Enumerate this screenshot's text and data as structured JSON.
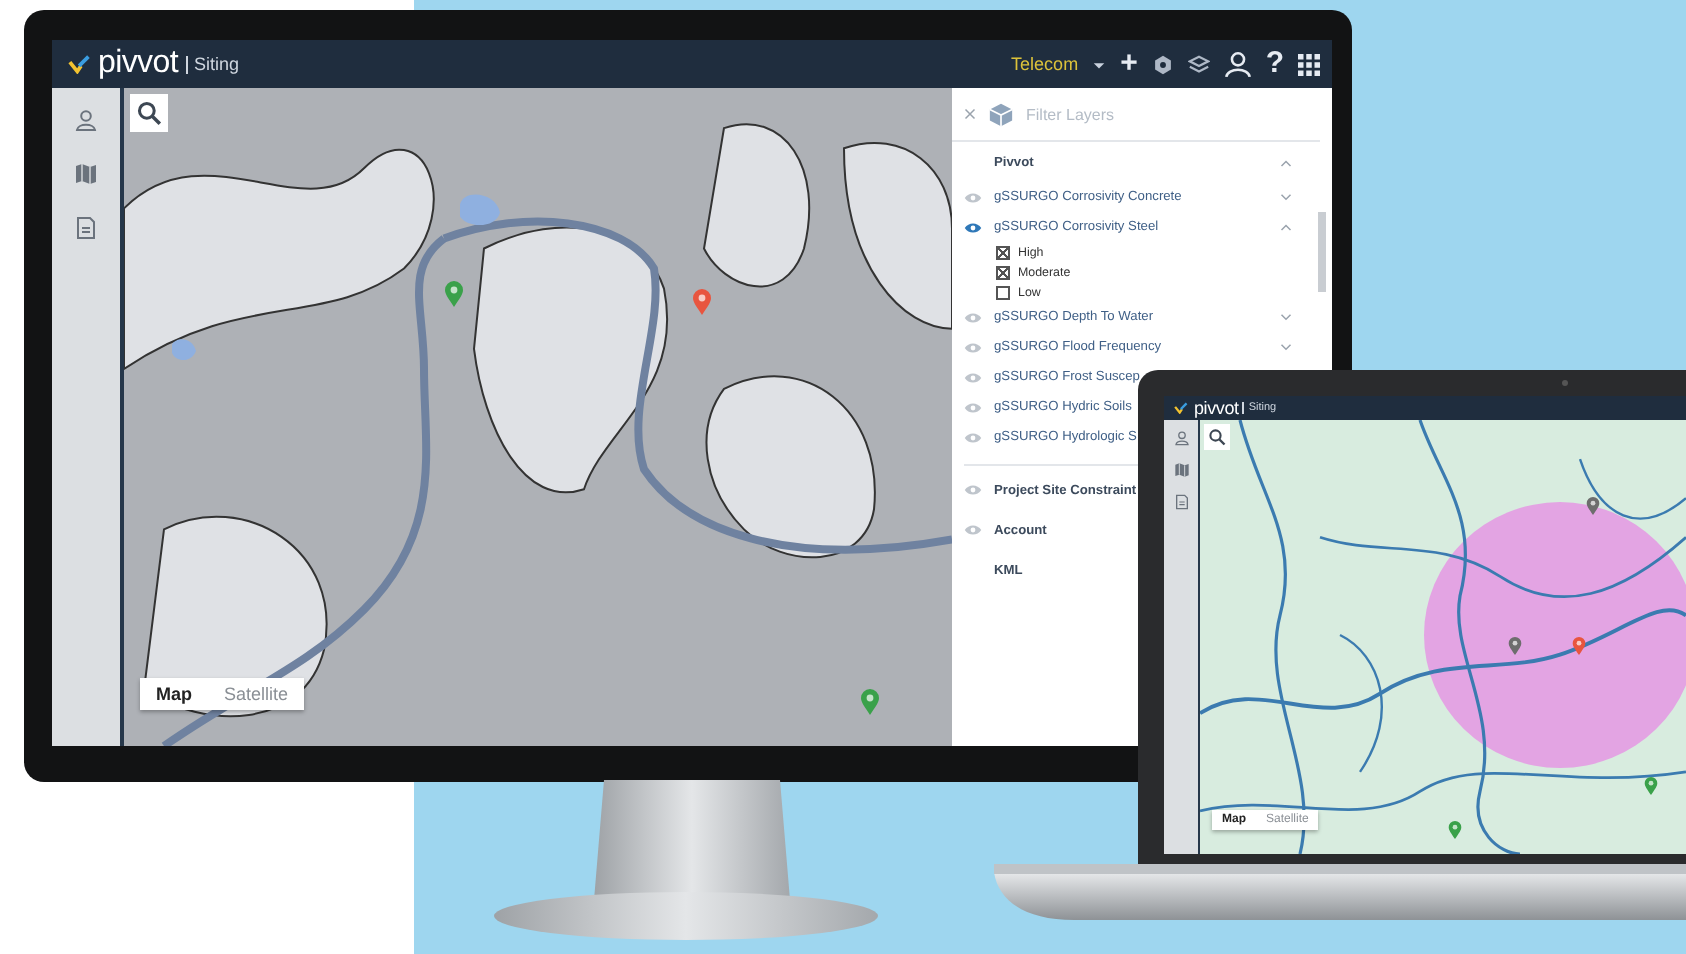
{
  "monitor": {
    "header": {
      "logo": "pivvot",
      "product": "Siting",
      "workspace": "Telecom",
      "add_button": "+",
      "help_button": "?"
    },
    "map": {
      "kind": "picture",
      "map_types": [
        {
          "label": "Map",
          "selected": true
        },
        {
          "label": "Satellite",
          "selected": false
        }
      ]
    },
    "layers_panel": {
      "filter": {
        "placeholder": "Filter Layers"
      },
      "groups": [
        {
          "label": "Pivvot",
          "expanded": true,
          "layers": [
            {
              "label": "gSSURGO Corrosivity Concrete",
              "visible": false,
              "expanded": false
            },
            {
              "label": "gSSURGO Corrosivity Steel",
              "visible": true,
              "expanded": true,
              "legend": [
                {
                  "label": "High",
                  "checked": true
                },
                {
                  "label": "Moderate",
                  "checked": true
                },
                {
                  "label": "Low",
                  "checked": false
                }
              ]
            },
            {
              "label": "gSSURGO Depth To Water",
              "visible": false,
              "expanded": false
            },
            {
              "label": "gSSURGO Flood Frequency",
              "visible": false,
              "expanded": false
            },
            {
              "label": "gSSURGO Frost Suscep",
              "visible": false
            },
            {
              "label": "gSSURGO Hydric Soils",
              "visible": false
            },
            {
              "label": "gSSURGO Hydrologic S",
              "visible": false
            }
          ]
        },
        {
          "label": "Project Site Constraint",
          "visible": false
        },
        {
          "label": "Account",
          "visible": false
        },
        {
          "label": "KML"
        }
      ]
    }
  },
  "laptop": {
    "header": {
      "logo": "pivvot",
      "product": "Siting"
    },
    "map": {
      "kind": "picture",
      "map_types": [
        {
          "label": "Map",
          "selected": true
        },
        {
          "label": "Satellite",
          "selected": false
        }
      ]
    }
  }
}
